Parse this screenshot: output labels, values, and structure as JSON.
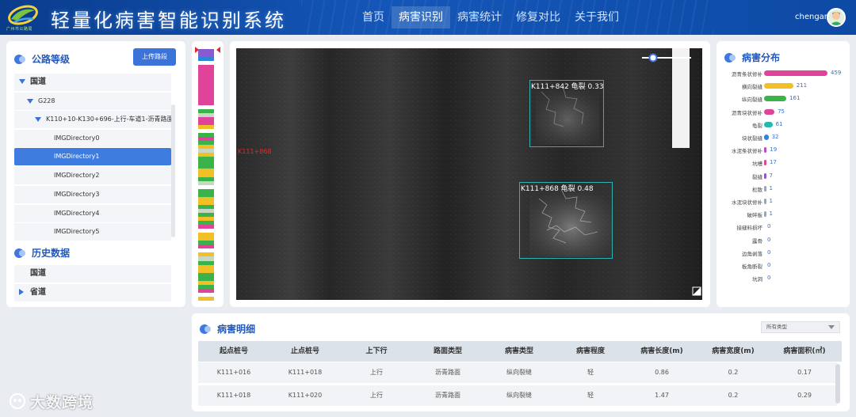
{
  "header": {
    "logo_subtitle": "广州市公路局",
    "title": "轻量化病害智能识别系统",
    "nav": [
      {
        "label": "首页"
      },
      {
        "label": "病害识别"
      },
      {
        "label": "病害统计"
      },
      {
        "label": "修复对比"
      },
      {
        "label": "关于我们"
      }
    ],
    "active_nav": "病害识别",
    "username": "chengan"
  },
  "left_panel": {
    "road_level_title": "公路等级",
    "upload_button": "上传路段",
    "tree": [
      {
        "label": "国道",
        "level": 0,
        "expanded": true
      },
      {
        "label": "G228",
        "level": 1,
        "expanded": true
      },
      {
        "label": "K110+10-K130+696-上行-车道1-沥青路面-...",
        "level": 2,
        "expanded": true
      },
      {
        "label": "IMGDirectory0",
        "level": 3
      },
      {
        "label": "IMGDirectory1",
        "level": 3,
        "selected": true
      },
      {
        "label": "IMGDirectory2",
        "level": 3
      },
      {
        "label": "IMGDirectory3",
        "level": 3
      },
      {
        "label": "IMGDirectory4",
        "level": 3
      },
      {
        "label": "IMGDirectory5",
        "level": 3
      }
    ],
    "history_title": "历史数据",
    "history_items": [
      {
        "label": "国道"
      },
      {
        "label": "省道"
      }
    ]
  },
  "image_view": {
    "side_label": "K111+868",
    "detections": [
      {
        "label": "K111+842 龟裂 0.33"
      },
      {
        "label": "K111+868 龟裂 0.48"
      }
    ],
    "slider_level": 0.25
  },
  "distribution": {
    "title": "病害分布",
    "items": [
      {
        "name": "沥青条状修补",
        "value": 459,
        "color": "#e0449a"
      },
      {
        "name": "横向裂缝",
        "value": 211,
        "color": "#f2c026"
      },
      {
        "name": "纵向裂缝",
        "value": 161,
        "color": "#3bb34b"
      },
      {
        "name": "沥青块状修补",
        "value": 75,
        "color": "#e0449a"
      },
      {
        "name": "龟裂",
        "value": 61,
        "color": "#23b8b0"
      },
      {
        "name": "块状裂缝",
        "value": 32,
        "color": "#2f86d8"
      },
      {
        "name": "水泥条状修补",
        "value": 19,
        "color": "#c04ac0"
      },
      {
        "name": "坑槽",
        "value": 17,
        "color": "#e0449a"
      },
      {
        "name": "裂缝",
        "value": 7,
        "color": "#8a5ad0"
      },
      {
        "name": "松散",
        "value": 1,
        "color": "#9aa5b5"
      },
      {
        "name": "水泥块状修补",
        "value": 1,
        "color": "#9aa5b5"
      },
      {
        "name": "破碎板",
        "value": 1,
        "color": "#9aa5b5"
      },
      {
        "name": "接缝料损坏",
        "value": 0,
        "color": "#9aa5b5"
      },
      {
        "name": "露骨",
        "value": 0,
        "color": "#9aa5b5"
      },
      {
        "name": "边角剥落",
        "value": 0,
        "color": "#9aa5b5"
      },
      {
        "name": "板角断裂",
        "value": 0,
        "color": "#9aa5b5"
      },
      {
        "name": "坑洞",
        "value": 0,
        "color": "#9aa5b5"
      }
    ]
  },
  "detail_table": {
    "title": "病害明细",
    "filter_value": "所有类型",
    "columns": [
      "起点桩号",
      "止点桩号",
      "上下行",
      "路面类型",
      "病害类型",
      "病害程度",
      "病害长度(m)",
      "病害宽度(m)",
      "病害面积(㎡)"
    ],
    "rows": [
      [
        "K111+016",
        "K111+018",
        "上行",
        "沥青路面",
        "纵向裂缝",
        "轻",
        "0.86",
        "0.2",
        "0.17"
      ],
      [
        "K111+018",
        "K111+020",
        "上行",
        "沥青路面",
        "纵向裂缝",
        "轻",
        "1.47",
        "0.2",
        "0.29"
      ]
    ]
  },
  "watermark": {
    "text": "大数跨境"
  },
  "strip_colors": [
    "#e0449a",
    "#f2c026",
    "#3bb34b",
    "#c8d6c4",
    "#ffffff",
    "#2f86d8",
    "#8a5ad0"
  ]
}
